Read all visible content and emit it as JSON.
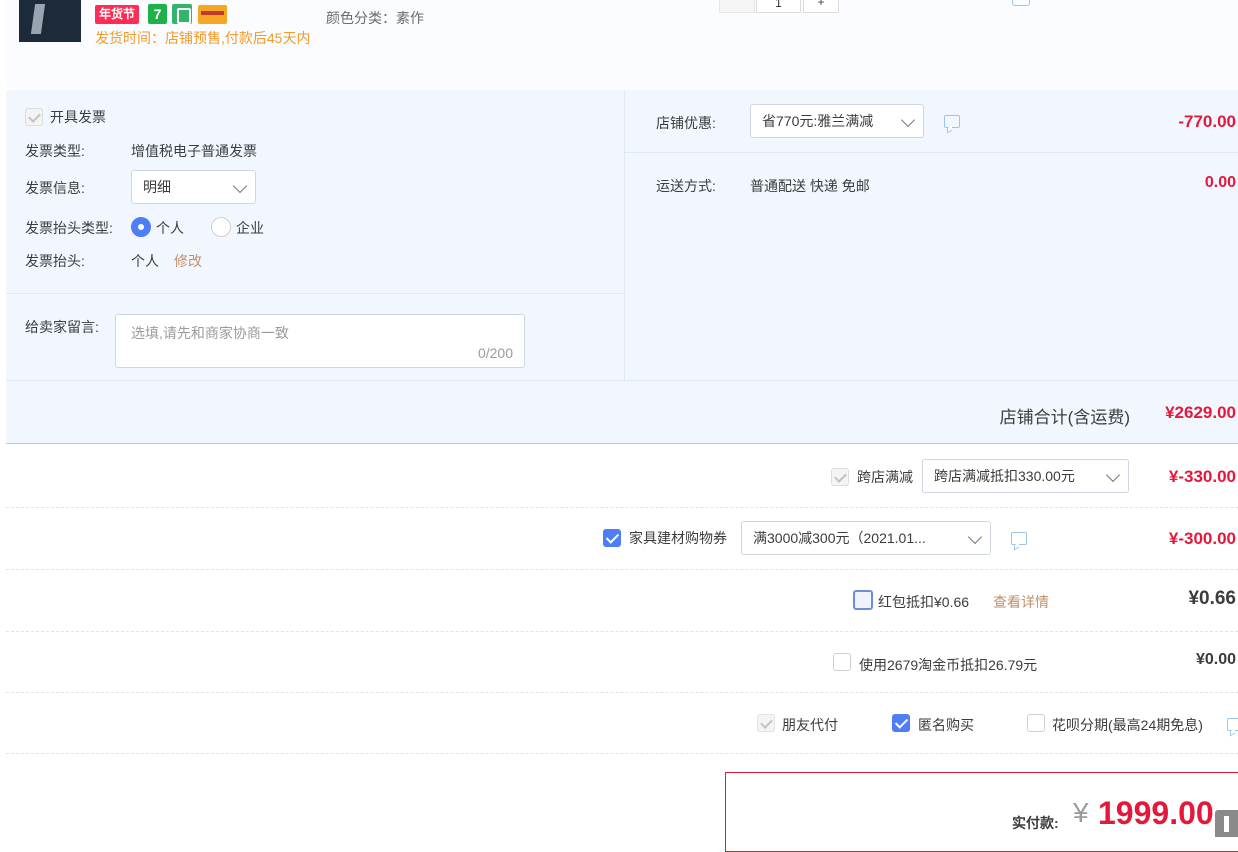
{
  "product": {
    "badge_nianhuojie": "年货节",
    "badge_seven": "7",
    "ship_time": "发货时间：店铺预售,付款后45天内",
    "color_label": "颜色分类：",
    "color_value": "素作",
    "quantity": "1",
    "qty_plus": "+"
  },
  "invoice": {
    "issue_label": "开具发票",
    "type_label": "发票类型:",
    "type_value": "增值税电子普通发票",
    "info_label": "发票信息:",
    "info_value": "明细",
    "title_type_label": "发票抬头类型:",
    "title_type_options": [
      "个人",
      "企业"
    ],
    "title_label": "发票抬头:",
    "title_value": "个人",
    "modify_link": "修改"
  },
  "message": {
    "label": "给卖家留言:",
    "placeholder": "选填,请先和商家协商一致",
    "count": "0/200"
  },
  "store": {
    "discount_label": "店铺优惠:",
    "discount_option": "省770元:雅兰满减",
    "discount_amount": "-770.00",
    "shipping_label": "运送方式:",
    "shipping_value": "普通配送 快递 免邮",
    "shipping_amount": "0.00",
    "total_label": "店铺合计(含运费)",
    "total_amount": "¥2629.00"
  },
  "discounts": {
    "cross_store_label": "跨店满减",
    "cross_store_option": "跨店满减抵扣330.00元",
    "cross_store_amount": "¥-330.00",
    "coupon_label": "家具建材购物券",
    "coupon_option": "满3000减300元（2021.01...",
    "coupon_amount": "¥-300.00",
    "redpacket_label": "红包抵扣¥0.66",
    "redpacket_link": "查看详情",
    "redpacket_amount": "¥0.66",
    "taojinbi_label": "使用2679淘金币抵扣26.79元",
    "taojinbi_amount": "¥0.00"
  },
  "options": {
    "friend_pay": "朋友代付",
    "anonymous": "匿名购买",
    "huabei": "花呗分期(最高24期免息)"
  },
  "payment": {
    "label": "实付款:",
    "currency": "¥",
    "amount": "1999.00"
  },
  "colors": {
    "accent_red": "#e4183a",
    "accent_blue": "#4d7ef5",
    "panel_bg": "#f2f7ff",
    "orange": "#f19a2b",
    "link_brown": "#c09069"
  }
}
